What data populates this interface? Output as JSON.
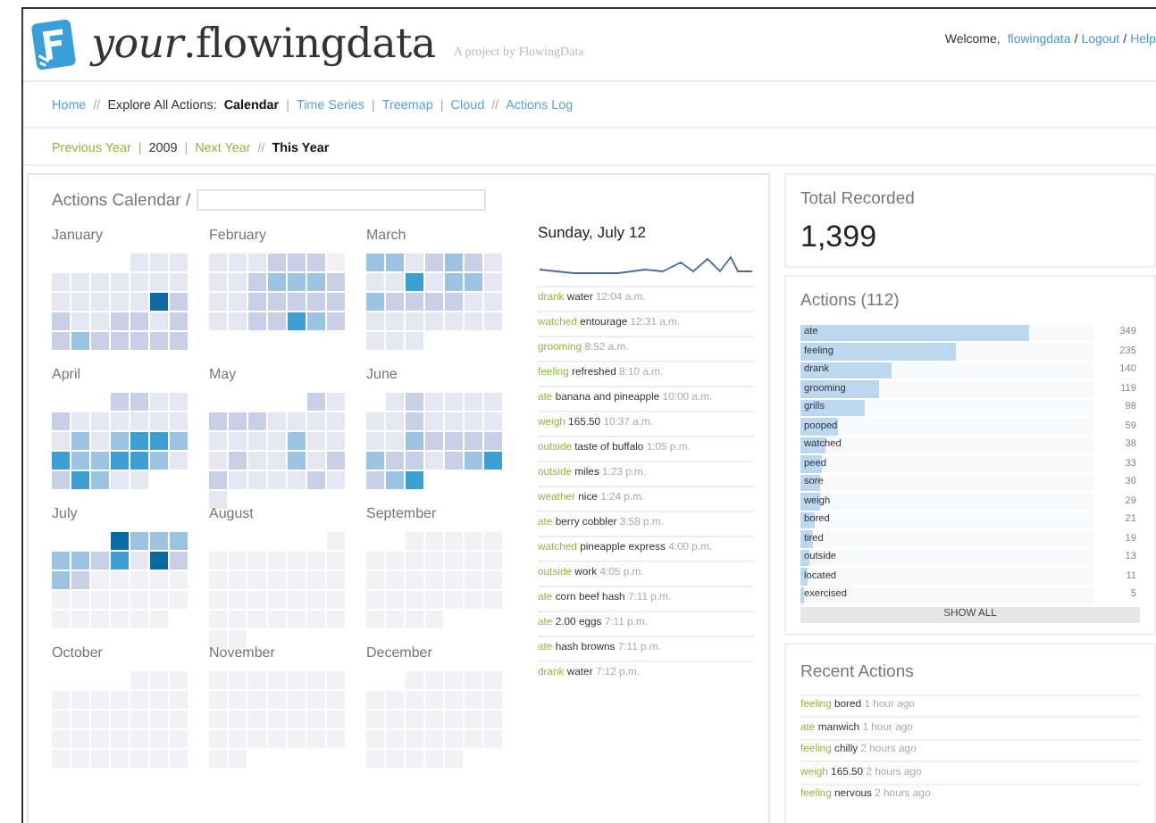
{
  "header": {
    "title_italic": "your",
    "title_rest": ".flowingdata",
    "tagline": "A project by FlowingData",
    "account": [
      {
        "kind": "text",
        "text": "Welcome,"
      },
      {
        "kind": "link",
        "text": "flowingdata"
      },
      {
        "kind": "sep",
        "text": "/"
      },
      {
        "kind": "link",
        "text": "Logout"
      },
      {
        "kind": "sep",
        "text": "/"
      },
      {
        "kind": "link",
        "text": "Help"
      }
    ]
  },
  "nav": [
    {
      "kind": "link",
      "text": "Home"
    },
    {
      "kind": "sep",
      "text": "//"
    },
    {
      "kind": "text",
      "text": "Explore All Actions:"
    },
    {
      "kind": "current",
      "text": "Calendar"
    },
    {
      "kind": "sep",
      "text": "|"
    },
    {
      "kind": "link",
      "text": "Time Series"
    },
    {
      "kind": "sep",
      "text": "|"
    },
    {
      "kind": "link",
      "text": "Treemap"
    },
    {
      "kind": "sep",
      "text": "|"
    },
    {
      "kind": "link",
      "text": "Cloud"
    },
    {
      "kind": "sep",
      "text": "//"
    },
    {
      "kind": "link",
      "text": "Actions Log"
    }
  ],
  "year_nav": [
    {
      "kind": "greenlink",
      "text": "Previous Year"
    },
    {
      "kind": "sep",
      "text": "|"
    },
    {
      "kind": "text",
      "text": "2009"
    },
    {
      "kind": "sep",
      "text": "|"
    },
    {
      "kind": "greenlink",
      "text": "Next Year"
    },
    {
      "kind": "sep",
      "text": "//"
    },
    {
      "kind": "current",
      "text": "This Year"
    }
  ],
  "calendar": {
    "title": "Actions Calendar /",
    "months": [
      {
        "name": "January"
      },
      {
        "name": "February"
      },
      {
        "name": "March"
      },
      {
        "name": "April"
      },
      {
        "name": "May"
      },
      {
        "name": "June"
      },
      {
        "name": "July"
      },
      {
        "name": "August"
      },
      {
        "name": "September"
      },
      {
        "name": "October"
      },
      {
        "name": "November"
      },
      {
        "name": "December"
      }
    ]
  },
  "day": {
    "title": "Sunday, July 12",
    "entries": [
      {
        "verb": "drank",
        "object": "water",
        "time": "12:04 a.m."
      },
      {
        "verb": "watched",
        "object": "entourage",
        "time": "12:31 a.m."
      },
      {
        "verb": "grooming",
        "time": "8:52 a.m."
      },
      {
        "verb": "feeling",
        "object": "refreshed",
        "time": "8:10 a.m."
      },
      {
        "verb": "ate",
        "object": "banana and pineapple",
        "time": "10:00 a.m."
      },
      {
        "verb": "weigh",
        "object": "165.50",
        "time": "10:37 a.m."
      },
      {
        "verb": "outside",
        "object": "taste of buffalo",
        "time": "1:05 p.m."
      },
      {
        "verb": "outside",
        "object": "miles",
        "time": "1:23 p.m."
      },
      {
        "verb": "weather",
        "object": "nice",
        "time": "1:24 p.m."
      },
      {
        "verb": "ate",
        "object": "berry cobbler",
        "time": "3:58 p.m."
      },
      {
        "verb": "watched",
        "object": "pineapple express",
        "time": "4:00 p.m."
      },
      {
        "verb": "outside",
        "object": "work",
        "time": "4:05 p.m."
      },
      {
        "verb": "ate",
        "object": "corn beef hash",
        "time": "7:11 p.m."
      },
      {
        "verb": "ate",
        "object": "2.00 eggs",
        "time": "7:11 p.m."
      },
      {
        "verb": "ate",
        "object": "hash browns",
        "time": "7:11 p.m."
      },
      {
        "verb": "drank",
        "object": "water",
        "time": "7:12 p.m."
      }
    ]
  },
  "total": {
    "title": "Total Recorded",
    "value": "1,399"
  },
  "actions": {
    "title": "Actions (112)",
    "show_all": "SHOW ALL",
    "items": [
      {
        "name": "ate",
        "count": "349",
        "level": 0.78
      },
      {
        "name": "feeling",
        "count": "235",
        "level": 0.53
      },
      {
        "name": "drank",
        "count": "140",
        "level": 0.31
      },
      {
        "name": "grooming",
        "count": "119",
        "level": 0.27
      },
      {
        "name": "grills",
        "count": "98",
        "level": 0.22
      },
      {
        "name": "pooped",
        "count": "59",
        "level": 0.13
      },
      {
        "name": "watched",
        "count": "38",
        "level": 0.085
      },
      {
        "name": "peed",
        "count": "33",
        "level": 0.074
      },
      {
        "name": "sore",
        "count": "30",
        "level": 0.067
      },
      {
        "name": "weigh",
        "count": "29",
        "level": 0.065
      },
      {
        "name": "bored",
        "count": "21",
        "level": 0.047
      },
      {
        "name": "tired",
        "count": "19",
        "level": 0.042
      },
      {
        "name": "outside",
        "count": "13",
        "level": 0.029
      },
      {
        "name": "located",
        "count": "11",
        "level": 0.025
      },
      {
        "name": "exercised",
        "count": "5",
        "level": 0.011
      }
    ]
  },
  "recent": {
    "title": "Recent Actions",
    "items": [
      {
        "verb": "feeling",
        "object": "bored",
        "time": "1 hour ago"
      },
      {
        "verb": "ate",
        "object": "manwich",
        "time": "1 hour ago"
      },
      {
        "verb": "feeling",
        "object": "chilly",
        "time": "2 hours ago"
      },
      {
        "verb": "weigh",
        "object": "165.50",
        "time": "2 hours ago"
      },
      {
        "verb": "feeling",
        "object": "nervous",
        "time": "2 hours ago"
      }
    ]
  }
}
